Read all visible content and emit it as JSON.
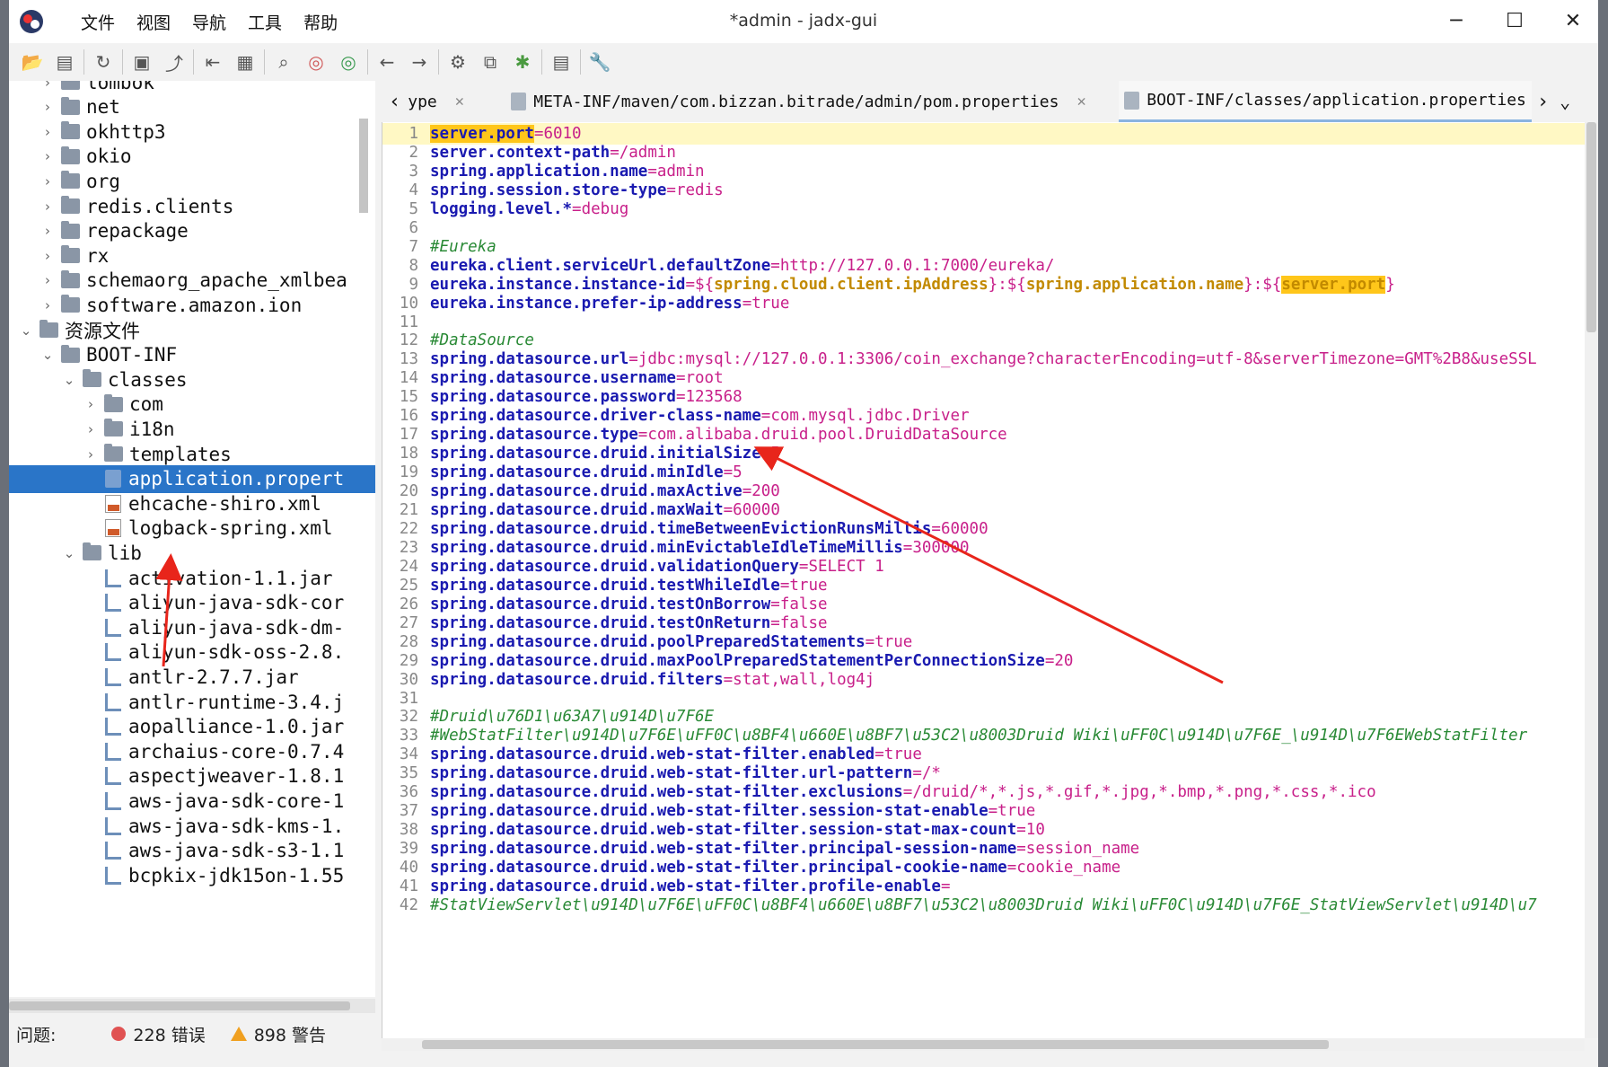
{
  "window": {
    "title": "*admin - jadx-gui",
    "menu": [
      "文件",
      "视图",
      "导航",
      "工具",
      "帮助"
    ],
    "controls": {
      "minimize": "─",
      "maximize": "☐",
      "close": "✕"
    }
  },
  "toolbar": {
    "icons": [
      "open-icon",
      "add-files-icon",
      "refresh-icon",
      "save-icon",
      "export-icon",
      "sync-icon",
      "flatten-packages-icon",
      "search-icon",
      "find-class-icon",
      "find-usage-icon",
      "back-icon",
      "forward-icon",
      "decompile-icon",
      "bookmark-icon",
      "debug-icon",
      "log-icon",
      "preferences-icon"
    ]
  },
  "tree": {
    "items": [
      {
        "label": "lombok",
        "depth": 1,
        "expand": "›",
        "type": "package"
      },
      {
        "label": "net",
        "depth": 1,
        "expand": "›",
        "type": "package"
      },
      {
        "label": "okhttp3",
        "depth": 1,
        "expand": "›",
        "type": "package"
      },
      {
        "label": "okio",
        "depth": 1,
        "expand": "›",
        "type": "package"
      },
      {
        "label": "org",
        "depth": 1,
        "expand": "›",
        "type": "package"
      },
      {
        "label": "redis.clients",
        "depth": 1,
        "expand": "›",
        "type": "package"
      },
      {
        "label": "repackage",
        "depth": 1,
        "expand": "›",
        "type": "package"
      },
      {
        "label": "rx",
        "depth": 1,
        "expand": "›",
        "type": "package"
      },
      {
        "label": "schemaorg_apache_xmlbea",
        "depth": 1,
        "expand": "›",
        "type": "package"
      },
      {
        "label": "software.amazon.ion",
        "depth": 1,
        "expand": "›",
        "type": "package"
      },
      {
        "label": "资源文件",
        "depth": 0,
        "expand": "⌄",
        "type": "folder"
      },
      {
        "label": "BOOT-INF",
        "depth": 1,
        "expand": "⌄",
        "type": "folder"
      },
      {
        "label": "classes",
        "depth": 2,
        "expand": "⌄",
        "type": "folder"
      },
      {
        "label": "com",
        "depth": 3,
        "expand": "›",
        "type": "folder"
      },
      {
        "label": "i18n",
        "depth": 3,
        "expand": "›",
        "type": "folder"
      },
      {
        "label": "templates",
        "depth": 3,
        "expand": "›",
        "type": "folder"
      },
      {
        "label": "application.propert",
        "depth": 3,
        "expand": "",
        "type": "prop",
        "selected": true
      },
      {
        "label": "ehcache-shiro.xml",
        "depth": 3,
        "expand": "",
        "type": "xml"
      },
      {
        "label": "logback-spring.xml",
        "depth": 3,
        "expand": "",
        "type": "xml"
      },
      {
        "label": "lib",
        "depth": 2,
        "expand": "⌄",
        "type": "folder"
      },
      {
        "label": "activation-1.1.jar",
        "depth": 3,
        "expand": "",
        "type": "jar"
      },
      {
        "label": "aliyun-java-sdk-cor",
        "depth": 3,
        "expand": "",
        "type": "jar"
      },
      {
        "label": "aliyun-java-sdk-dm-",
        "depth": 3,
        "expand": "",
        "type": "jar"
      },
      {
        "label": "aliyun-sdk-oss-2.8.",
        "depth": 3,
        "expand": "",
        "type": "jar"
      },
      {
        "label": "antlr-2.7.7.jar",
        "depth": 3,
        "expand": "",
        "type": "jar"
      },
      {
        "label": "antlr-runtime-3.4.j",
        "depth": 3,
        "expand": "",
        "type": "jar"
      },
      {
        "label": "aopalliance-1.0.jar",
        "depth": 3,
        "expand": "",
        "type": "jar"
      },
      {
        "label": "archaius-core-0.7.4",
        "depth": 3,
        "expand": "",
        "type": "jar"
      },
      {
        "label": "aspectjweaver-1.8.1",
        "depth": 3,
        "expand": "",
        "type": "jar"
      },
      {
        "label": "aws-java-sdk-core-1",
        "depth": 3,
        "expand": "",
        "type": "jar"
      },
      {
        "label": "aws-java-sdk-kms-1.",
        "depth": 3,
        "expand": "",
        "type": "jar"
      },
      {
        "label": "aws-java-sdk-s3-1.1",
        "depth": 3,
        "expand": "",
        "type": "jar"
      },
      {
        "label": "bcpkix-jdk15on-1.55",
        "depth": 3,
        "expand": "",
        "type": "jar"
      }
    ]
  },
  "status": {
    "problems_label": "问题:",
    "errors": "228 错误",
    "warnings": "898 警告"
  },
  "tabs": [
    {
      "label": "ype",
      "has_icon": false
    },
    {
      "label": "META-INF/maven/com.bizzan.bitrade/admin/pom.properties",
      "has_icon": true
    },
    {
      "label": "BOOT-INF/classes/application.properties",
      "has_icon": true,
      "active": true
    }
  ],
  "tab_nav": {
    "prev": "‹",
    "next": "›",
    "menu": "⌄"
  },
  "code": [
    {
      "n": "1",
      "key": "server.port",
      "val": "6010",
      "highlight_key": true
    },
    {
      "n": "2",
      "key": "server.context-path",
      "val": "/admin"
    },
    {
      "n": "3",
      "key": "spring.application.name",
      "val": "admin"
    },
    {
      "n": "4",
      "key": "spring.session.store-type",
      "val": "redis"
    },
    {
      "n": "5",
      "key": "logging.level.*",
      "val": "debug"
    },
    {
      "n": "6",
      "blank": true
    },
    {
      "n": "7",
      "comment": "#Eureka"
    },
    {
      "n": "8",
      "key": "eureka.client.serviceUrl.defaultZone",
      "val": "http://127.0.0.1:7000/eureka/"
    },
    {
      "n": "9",
      "key": "eureka.instance.instance-id",
      "special9": true
    },
    {
      "n": "10",
      "key": "eureka.instance.prefer-ip-address",
      "val": "true"
    },
    {
      "n": "11",
      "blank": true
    },
    {
      "n": "12",
      "comment": "#DataSource"
    },
    {
      "n": "13",
      "key": "spring.datasource.url",
      "val": "jdbc:mysql://127.0.0.1:3306/coin_exchange?characterEncoding=utf-8&serverTimezone=GMT%2B8&useSSL"
    },
    {
      "n": "14",
      "key": "spring.datasource.username",
      "val": "root"
    },
    {
      "n": "15",
      "key": "spring.datasource.password",
      "val": "123568"
    },
    {
      "n": "16",
      "key": "spring.datasource.driver-class-name",
      "val": "com.mysql.jdbc.Driver"
    },
    {
      "n": "17",
      "key": "spring.datasource.type",
      "val": "com.alibaba.druid.pool.DruidDataSource"
    },
    {
      "n": "18",
      "key": "spring.datasource.druid.initialSize",
      "val": "5"
    },
    {
      "n": "19",
      "key": "spring.datasource.druid.minIdle",
      "val": "5"
    },
    {
      "n": "20",
      "key": "spring.datasource.druid.maxActive",
      "val": "200"
    },
    {
      "n": "21",
      "key": "spring.datasource.druid.maxWait",
      "val": "60000"
    },
    {
      "n": "22",
      "key": "spring.datasource.druid.timeBetweenEvictionRunsMillis",
      "val": "60000"
    },
    {
      "n": "23",
      "key": "spring.datasource.druid.minEvictableIdleTimeMillis",
      "val": "300000"
    },
    {
      "n": "24",
      "key": "spring.datasource.druid.validationQuery",
      "val": "SELECT 1"
    },
    {
      "n": "25",
      "key": "spring.datasource.druid.testWhileIdle",
      "val": "true"
    },
    {
      "n": "26",
      "key": "spring.datasource.druid.testOnBorrow",
      "val": "false"
    },
    {
      "n": "27",
      "key": "spring.datasource.druid.testOnReturn",
      "val": "false"
    },
    {
      "n": "28",
      "key": "spring.datasource.druid.poolPreparedStatements",
      "val": "true"
    },
    {
      "n": "29",
      "key": "spring.datasource.druid.maxPoolPreparedStatementPerConnectionSize",
      "val": "20"
    },
    {
      "n": "30",
      "key": "spring.datasource.druid.filters",
      "val": "stat,wall,log4j"
    },
    {
      "n": "31",
      "blank": true
    },
    {
      "n": "32",
      "comment": "#Druid\\u76D1\\u63A7\\u914D\\u7F6E"
    },
    {
      "n": "33",
      "comment": "#WebStatFilter\\u914D\\u7F6E\\uFF0C\\u8BF4\\u660E\\u8BF7\\u53C2\\u8003Druid Wiki\\uFF0C\\u914D\\u7F6E_\\u914D\\u7F6EWebStatFilter"
    },
    {
      "n": "34",
      "key": "spring.datasource.druid.web-stat-filter.enabled",
      "val": "true"
    },
    {
      "n": "35",
      "key": "spring.datasource.druid.web-stat-filter.url-pattern",
      "val": "/*"
    },
    {
      "n": "36",
      "key": "spring.datasource.druid.web-stat-filter.exclusions",
      "val": "/druid/*,*.js,*.gif,*.jpg,*.bmp,*.png,*.css,*.ico"
    },
    {
      "n": "37",
      "key": "spring.datasource.druid.web-stat-filter.session-stat-enable",
      "val": "true"
    },
    {
      "n": "38",
      "key": "spring.datasource.druid.web-stat-filter.session-stat-max-count",
      "val": "10"
    },
    {
      "n": "39",
      "key": "spring.datasource.druid.web-stat-filter.principal-session-name",
      "val": "session_name"
    },
    {
      "n": "40",
      "key": "spring.datasource.druid.web-stat-filter.principal-cookie-name",
      "val": "cookie_name"
    },
    {
      "n": "41",
      "key": "spring.datasource.druid.web-stat-filter.profile-enable",
      "val": ""
    },
    {
      "n": "42",
      "comment": "#StatViewServlet\\u914D\\u7F6E\\uFF0C\\u8BF4\\u660E\\u8BF7\\u53C2\\u8003Druid Wiki\\uFF0C\\u914D\\u7F6E_StatViewServlet\\u914D\\u7"
    }
  ],
  "line9": {
    "open1": "${",
    "ph1": "spring.cloud.client.ipAddress",
    "close1": "}",
    "sep1": ":",
    "open2": "${",
    "ph2": "spring.application.name",
    "close2": "}",
    "sep2": ":",
    "open3": "${",
    "ph3": "server.port",
    "close3": "}"
  },
  "colors": {
    "selection": "#2a75c8",
    "key": "#1a1ab0",
    "value": "#c8208a",
    "comment": "#2a8a36",
    "highlight": "#ffc61a",
    "annotation_arrow": "#e8251b"
  }
}
